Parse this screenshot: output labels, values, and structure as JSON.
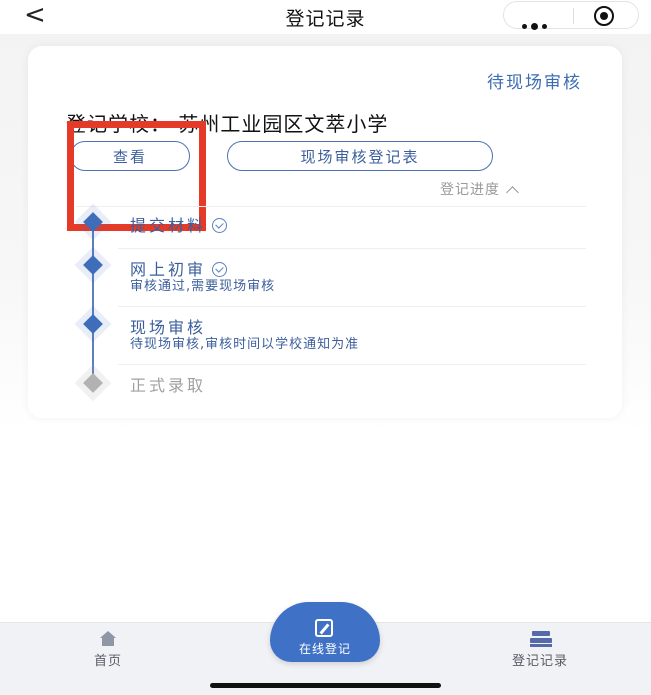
{
  "nav": {
    "back_glyph": "<",
    "title": "登记记录"
  },
  "card": {
    "status": "待现场审核",
    "school": "登记学校： 苏州工业园区文萃小学",
    "view_button": "查看",
    "form_button": "现场审核登记表",
    "progress_toggle": "登记进度"
  },
  "steps": [
    {
      "title": "提交材料",
      "subtitle": "",
      "done": true
    },
    {
      "title": "网上初审",
      "subtitle": "审核通过,需要现场审核",
      "done": true
    },
    {
      "title": "现场审核",
      "subtitle": "待现场审核,审核时间以学校通知为准",
      "done": false
    },
    {
      "title": "正式录取",
      "subtitle": "",
      "done": false
    }
  ],
  "tabbar": {
    "home": "首页",
    "center": "在线登记",
    "records": "登记记录"
  },
  "colors": {
    "accent": "#3e6fba",
    "highlight": "#e53a27",
    "pending": "#b5b5b5"
  }
}
